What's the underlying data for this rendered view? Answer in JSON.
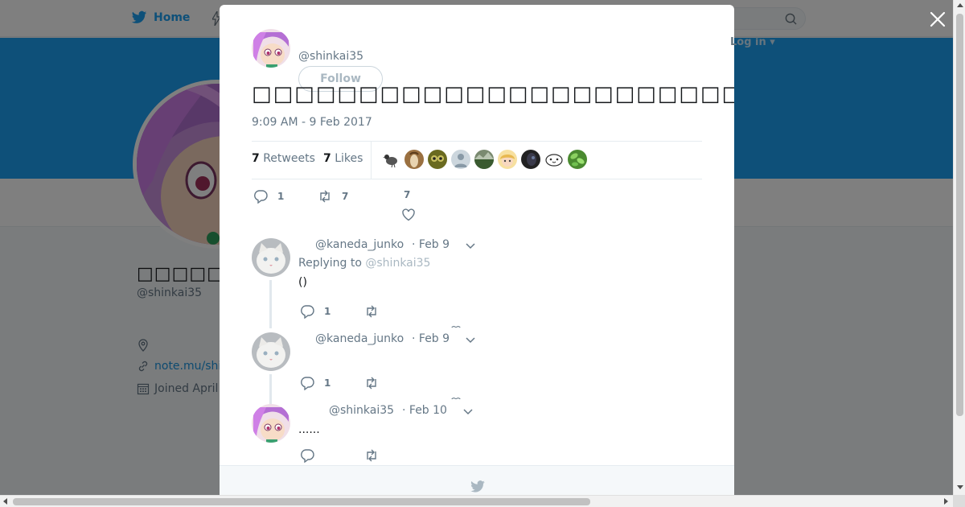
{
  "colors": {
    "accent": "#1da1f2",
    "text_primary": "#14171a",
    "text_secondary": "#657786",
    "border": "#e6ecf0"
  },
  "topbar": {
    "home_label": "Home",
    "login_label": "Log in"
  },
  "profile": {
    "name": "□□□□□□□□□",
    "handle": "@shinkai35",
    "location_icon": "location-pin-icon",
    "link_text": "note.mu/shi",
    "joined_text": "Joined April"
  },
  "tweet": {
    "handle": "@shinkai35",
    "follow_label": "Follow",
    "text": "□□□□□□□□□□□□□□□□□□□□□□□□□□□□□□□□□□□□□□□□□□□□□□□□□□□□□□",
    "timestamp": "9:09 AM - 9 Feb 2017",
    "retweets_count": "7",
    "retweets_label": "Retweets",
    "likes_count": "7",
    "likes_label": "Likes",
    "likers": [
      "pigeon",
      "portrait-brown",
      "olive-creature",
      "default-gray",
      "landscape",
      "blonde-anime",
      "dark-portrait",
      "cute-face",
      "green-leaves"
    ],
    "reply_count": "1",
    "retweet_count": "7",
    "like_count": "7"
  },
  "replies": [
    {
      "handle": "@kaneda_junko",
      "date": "· Feb 9",
      "replying_prefix": "Replying to",
      "replying_to": "@shinkai35",
      "text": "()",
      "reply_count": "1"
    },
    {
      "handle": "@kaneda_junko",
      "date": "· Feb 9",
      "text": "",
      "reply_count": "1"
    },
    {
      "handle": "@shinkai35",
      "date": "· Feb 10",
      "text": "......",
      "reply_count": ""
    }
  ]
}
